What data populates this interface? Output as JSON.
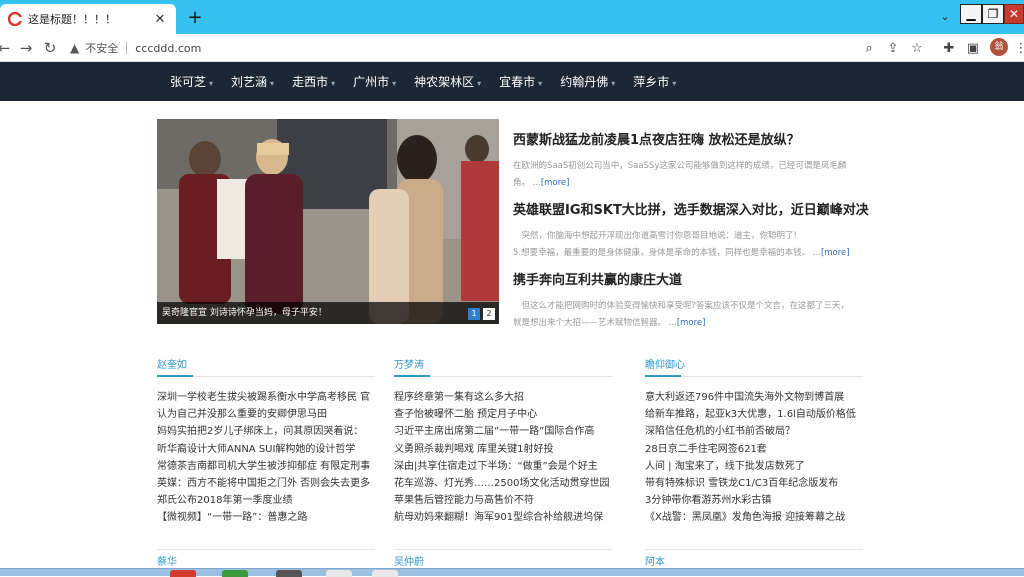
{
  "browser": {
    "tab_title": "这是标题！！！！",
    "tab_close": "✕",
    "new_tab": "+",
    "security_label": "不安全",
    "url": "cccddd.com",
    "avatar_text": "翁"
  },
  "nav": {
    "items": [
      "张可芝",
      "刘艺涵",
      "走西市",
      "广州市",
      "神农架林区",
      "宜春市",
      "约翰丹佛",
      "萍乡市"
    ]
  },
  "hero": {
    "caption": "吴奇隆官宣  刘诗诗怀孕当妈，母子平安！",
    "pages": [
      "1",
      "2"
    ]
  },
  "articles": [
    {
      "title": "西蒙斯战猛龙前凌晨1点夜店狂嗨 放松还是放纵？",
      "lines": [
        "在欧洲的SaaS初创公司当中，SaaSSy这家公司能够做到这样的成绩，已经可谓是凤毛麟",
        "角。"
      ],
      "more": "[more]"
    },
    {
      "title": "英雄联盟IG和SKT大比拼，选手数据深入对比，近日巅峰对决",
      "lines": [
        "　突然，你脑海中想起开浮现出你道高雪讨你恩哥目地说：道主，你聪明了!",
        "5.想要幸福，最重要的是身体健康，身体是革命的本钱，同样也是幸福的本钱。"
      ],
      "more": "[more]"
    },
    {
      "title": "携手奔向互利共赢的康庄大道",
      "lines": [
        "　但这么才能把网购时的体验变得愉快和享受呢?答案应该不仅是个文言，在这都了三天，",
        "就是想出来个大招——艺术赋物信智器。"
      ],
      "more": "[more]"
    }
  ],
  "columns": [
    {
      "header": "赵奎如",
      "items": [
        "深圳一学校老生拔尖被踢系衡水中学高考移民 官",
        "认为自己并没那么重要的安卿伊思马田",
        "妈妈实拍把2岁儿子绑床上，问其原因哭着说：",
        "听华裔设计大师ANNA SUI解构她的设计哲学",
        "常德茶吉南都司机大学生被涉抑郁症 有限定刑事",
        "英媒：西方不能将中国拒之门外 否则会失去更多",
        "郑氏公布2018年第一季度业绩",
        "【微视频】“一带一路”：普惠之路"
      ],
      "next": "蔡华"
    },
    {
      "header": "万梦涛",
      "items": [
        "程序终章第一集有这么多大招",
        "查子怡被曝怀二胎 预定月子中心",
        "习近平主席出席第二届“一带一路”国际合作高",
        "义勇照杀裁判喝戏 库里关键1射好投",
        "深由|共享住宿走过下半场：“做重”会是个好主",
        "花车巡游、灯光秀……2500场文化活动贯穿世园",
        "苹果售后管控能力与高售价不符",
        "航母劝妈来翻糊！海军901型综合补给舰进坞保"
      ],
      "next": "吴仲蔚"
    },
    {
      "header": "瞻仰御心",
      "items": [
        "意大利返还796件中国流失海外文物到博首展",
        "给新车推路，起亚k3大优惠，1.6l自动版价格低",
        "深陷信任危机的小红书前否破局？",
        "28日京二手住宅网签621套",
        "人间 | 淘宝来了，线下批发店数死了",
        "带有特殊标识 雪铁龙C1/C3百年纪念版发布",
        "3分钟带你看游苏州水彩古镇",
        "《X战警：黑凤凰》发角色海报 迎接筹幕之战"
      ],
      "next": "阿本"
    }
  ]
}
